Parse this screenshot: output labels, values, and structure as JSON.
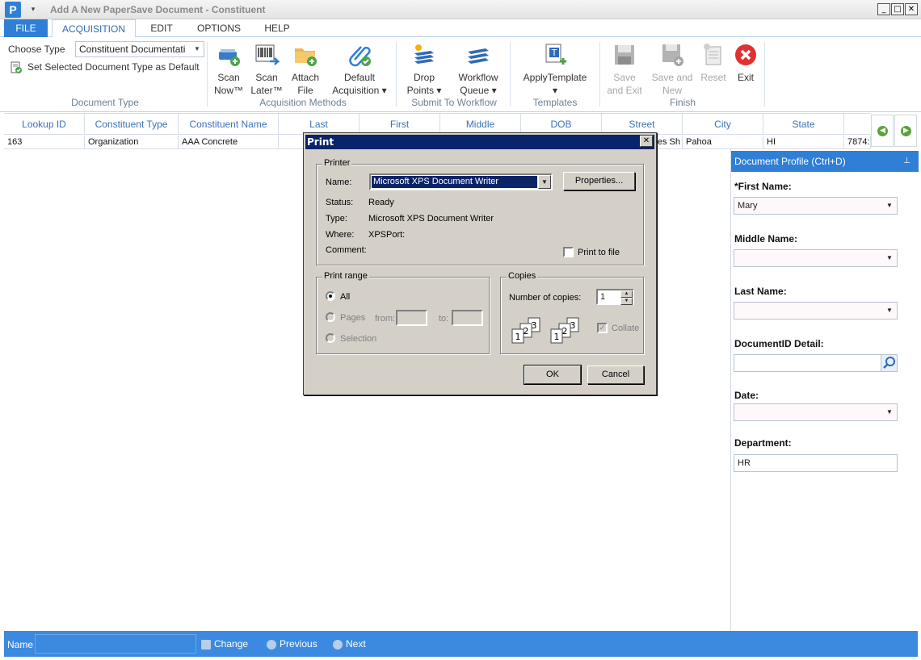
{
  "window": {
    "title": "Add A New PaperSave Document - Constituent",
    "logo": "P"
  },
  "menu": {
    "file": "FILE",
    "acquisition": "ACQUISITION",
    "edit": "EDIT",
    "options": "OPTIONS",
    "help": "HELP"
  },
  "ribbon": {
    "choose_type_label": "Choose Type",
    "choose_type_value": "Constituent Documentati",
    "set_default_label": "Set Selected Document Type as Default",
    "group_document_type": "Document Type",
    "scan_now": [
      "Scan",
      "Now™"
    ],
    "scan_later": [
      "Scan",
      "Later™"
    ],
    "attach_file": [
      "Attach",
      "File"
    ],
    "default_acquisition": [
      "Default",
      "Acquisition ▾"
    ],
    "group_acquisition": "Acquisition Methods",
    "drop_points": [
      "Drop",
      "Points ▾"
    ],
    "workflow_queue": [
      "Workflow",
      "Queue ▾"
    ],
    "group_workflow": "Submit To Workflow",
    "apply_template": [
      "ApplyTemplate",
      "▾"
    ],
    "group_templates": "Templates",
    "save_exit": [
      "Save",
      "and Exit"
    ],
    "save_new": [
      "Save and",
      "New"
    ],
    "reset": "Reset",
    "exit": "Exit",
    "group_finish": "Finish"
  },
  "grid": {
    "columns": [
      "Lookup ID",
      "Constituent Type",
      "Constituent Name",
      "Last",
      "First",
      "Middle",
      "DOB",
      "Street",
      "City",
      "State"
    ],
    "row": [
      "163",
      "Organization",
      "AAA Concrete",
      "",
      "",
      "",
      "",
      "tes Sh",
      "Pahoa",
      "HI",
      "7874:"
    ]
  },
  "profile": {
    "header": "Document Profile (Ctrl+D)",
    "pin": "⊥",
    "first_name_label": "*First Name:",
    "first_name_value": "Mary",
    "middle_name_label": "Middle Name:",
    "middle_name_value": "",
    "last_name_label": "Last Name:",
    "last_name_value": "",
    "document_id_label": "DocumentID Detail:",
    "document_id_value": "",
    "date_label": "Date:",
    "date_value": "",
    "department_label": "Department:",
    "department_value": "HR"
  },
  "statusbar": {
    "name_label": "Name",
    "name_value": "",
    "change": "Change",
    "previous": "Previous",
    "next": "Next"
  },
  "print_dialog": {
    "title": "Print",
    "close": "✕",
    "printer_legend": "Printer",
    "name_label": "Name:",
    "name_value": "Microsoft XPS Document Writer",
    "properties_button": "Properties...",
    "status_label": "Status:",
    "status_value": "Ready",
    "type_label": "Type:",
    "type_value": "Microsoft XPS Document Writer",
    "where_label": "Where:",
    "where_value": "XPSPort:",
    "comment_label": "Comment:",
    "print_to_file": "Print to file",
    "range_legend": "Print range",
    "all": "All",
    "pages": "Pages",
    "from": "from:",
    "to": "to:",
    "selection": "Selection",
    "copies_legend": "Copies",
    "number_of_copies_label": "Number of copies:",
    "number_of_copies_value": "1",
    "collate": "Collate",
    "ok_button": "OK",
    "cancel_button": "Cancel"
  },
  "colors": {
    "accent": "#2f7fd6",
    "statusbar": "#3c8ae0",
    "dialog_bg": "#d4d0c8",
    "dialog_title": "#0a246a"
  }
}
